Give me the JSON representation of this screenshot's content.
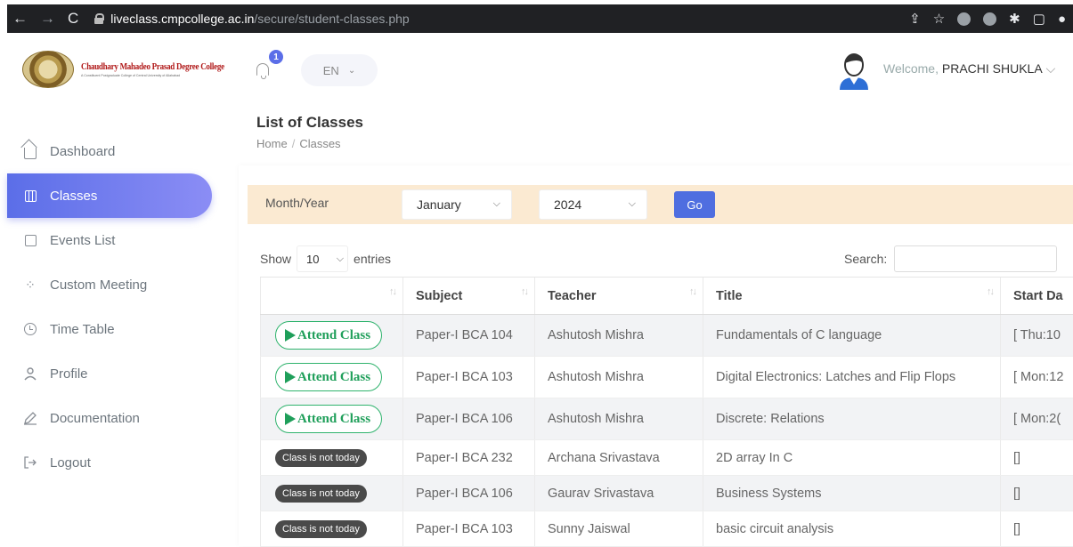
{
  "browser": {
    "domain": "liveclass.cmpcollege.ac.in",
    "path": "/secure/student-classes.php"
  },
  "college": {
    "name": "Chaudhary Mahadeo Prasad Degree College",
    "subtitle": "A Constituent Postgraduate College of Central University of Allahabad"
  },
  "header": {
    "notification_count": "1",
    "language": "EN",
    "welcome": "Welcome,",
    "user_name": "PRACHI SHUKLA"
  },
  "sidebar": {
    "items": [
      {
        "label": "Dashboard",
        "icon": "home-icon"
      },
      {
        "label": "Classes",
        "icon": "board-icon"
      },
      {
        "label": "Events List",
        "icon": "document-icon"
      },
      {
        "label": "Custom Meeting",
        "icon": "network-icon"
      },
      {
        "label": "Time Table",
        "icon": "clock-icon"
      },
      {
        "label": "Profile",
        "icon": "user-icon"
      },
      {
        "label": "Documentation",
        "icon": "pencil-icon"
      },
      {
        "label": "Logout",
        "icon": "logout-icon"
      }
    ],
    "active_index": 1,
    "accent": "#5b6ee8"
  },
  "page": {
    "title": "List of Classes",
    "breadcrumb": [
      "Home",
      "Classes"
    ]
  },
  "filter": {
    "label": "Month/Year",
    "month": "January",
    "year": "2024",
    "go_label": "Go"
  },
  "table_controls": {
    "show_label": "Show",
    "entries_value": "10",
    "entries_label": "entries",
    "search_label": "Search:"
  },
  "table": {
    "columns": [
      "",
      "Subject",
      "Teacher",
      "Title",
      "Start Da"
    ],
    "rows": [
      {
        "action": "Attend Class",
        "subject": "Paper-I BCA 104",
        "teacher": "Ashutosh Mishra",
        "title": "Fundamentals of C language",
        "start": "[ Thu:10"
      },
      {
        "action": "Attend Class",
        "subject": "Paper-I BCA 103",
        "teacher": "Ashutosh Mishra",
        "title": "Digital Electronics: Latches and Flip Flops",
        "start": "[ Mon:12"
      },
      {
        "action": "Attend Class",
        "subject": "Paper-I BCA 106",
        "teacher": "Ashutosh Mishra",
        "title": "Discrete: Relations",
        "start": "[ Mon:2("
      },
      {
        "action": "Class is not today",
        "subject": "Paper-I BCA 232",
        "teacher": "Archana Srivastava",
        "title": "2D array In C",
        "start": "[]"
      },
      {
        "action": "Class is not today",
        "subject": "Paper-I BCA 106",
        "teacher": "Gaurav Srivastava",
        "title": "Business Systems",
        "start": "[]"
      },
      {
        "action": "Class is not today",
        "subject": "Paper-I BCA 103",
        "teacher": "Sunny Jaiswal",
        "title": "basic circuit analysis",
        "start": "[]"
      }
    ]
  }
}
